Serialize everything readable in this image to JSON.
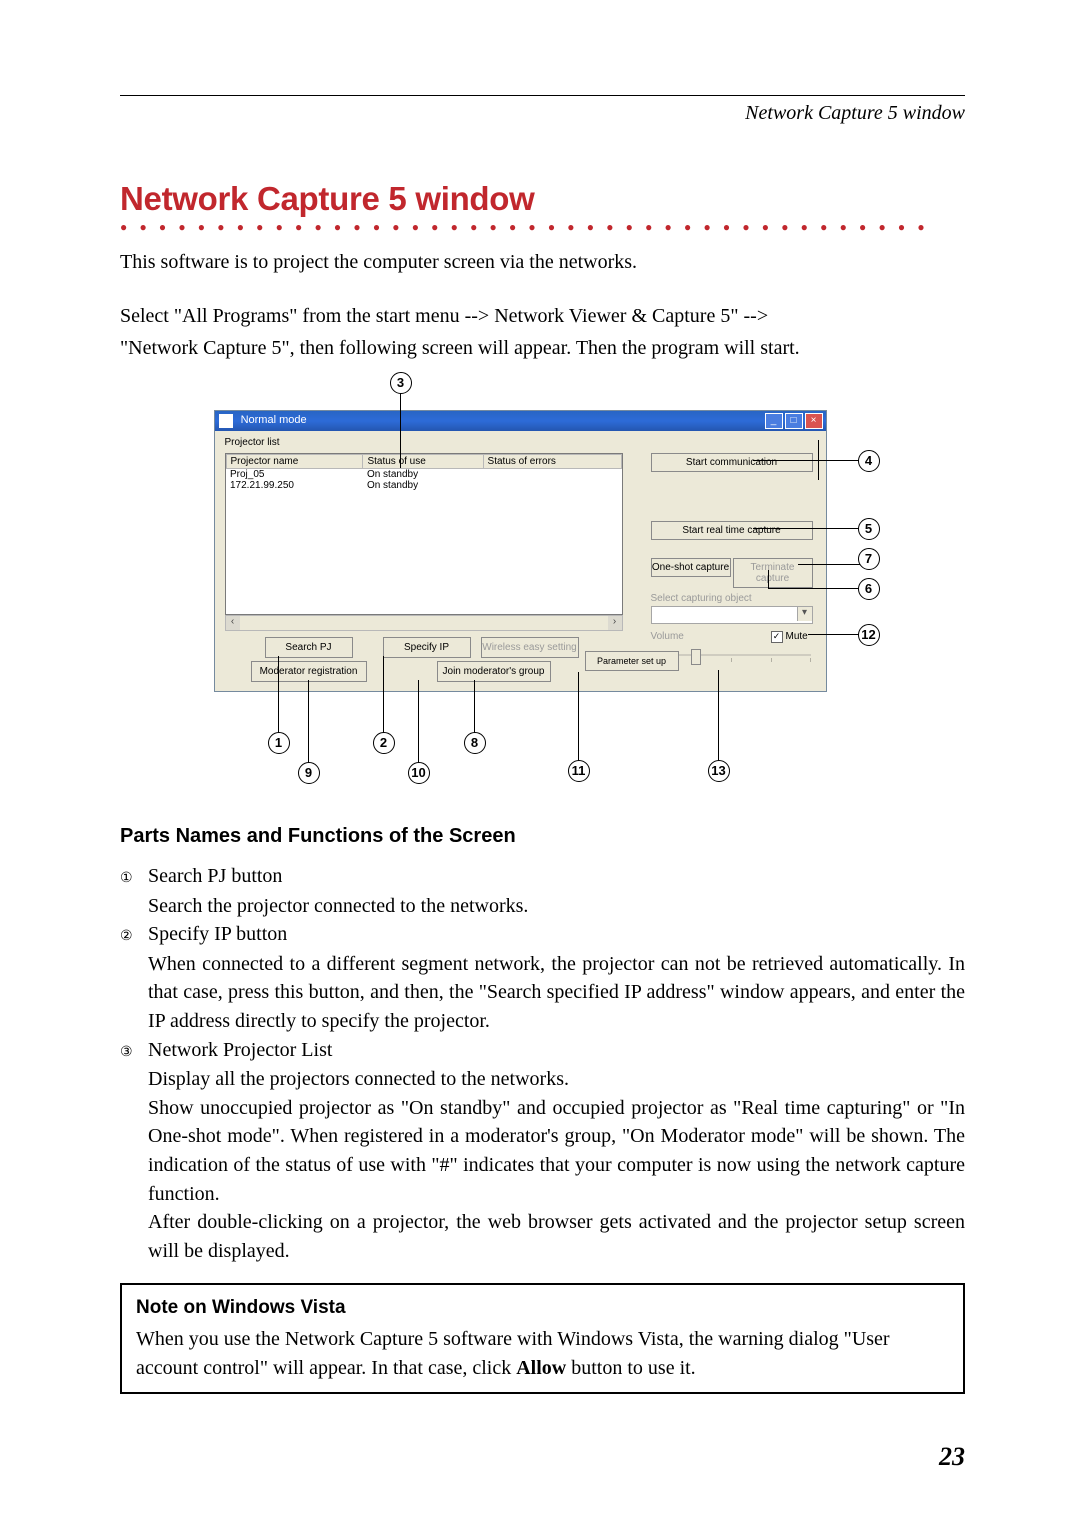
{
  "header": {
    "breadcrumb": "Network Capture 5 window"
  },
  "title": "Network Capture 5 window",
  "intro1": "This software is to project the computer screen via the networks.",
  "intro2": "Select  \"All Programs\" from the start menu --> Network Viewer & Capture 5\" -->",
  "intro3": "\"Network Capture 5\", then following screen will appear. Then the program will start.",
  "win": {
    "title": "Normal mode",
    "projector_list_label": "Projector list",
    "columns": {
      "name": "Projector name",
      "status": "Status of use",
      "errors": "Status of errors"
    },
    "rows": [
      {
        "name": "Proj_05",
        "status": "On standby"
      },
      {
        "name": "172.21.99.250",
        "status": "On standby"
      }
    ],
    "buttons": {
      "start_comm": "Start communication",
      "start_rt": "Start real time capture",
      "oneshot": "One-shot capture",
      "terminate": "Terminate capture",
      "select_obj_label": "Select capturing object",
      "volume_label": "Volume",
      "mute": "Mute",
      "search": "Search PJ",
      "specify": "Specify IP",
      "wireless": "Wireless easy setting",
      "param": "Parameter set up",
      "moderator": "Moderator registration",
      "join": "Join moderator's group"
    }
  },
  "callouts": [
    "①",
    "②",
    "③",
    "④",
    "⑤",
    "⑥",
    "⑦",
    "⑧",
    "⑨",
    "⑩",
    "⑪",
    "⑫",
    "⑬"
  ],
  "parts_heading": "Parts Names and Functions of the Screen",
  "parts": [
    {
      "num": "①",
      "label": "Search PJ button",
      "desc": "Search the projector connected to the networks."
    },
    {
      "num": "②",
      "label": "Specify IP button",
      "desc": "When connected to a different segment network, the projector can not be retrieved automatically. In that case, press this button, and then, the \"Search specified IP address\" window appears, and enter the IP address directly to specify the projector."
    },
    {
      "num": "③",
      "label": "Network Projector List",
      "desc": "Display all the projectors connected to the networks.\nShow unoccupied projector as \"On standby\" and occupied projector as \"Real time capturing\" or \"In One-shot mode\".  When registered in a moderator's group, \"On Moderator mode\" will be shown. The indication of the status of use with \"#\" indicates that your computer is now using the network capture function.\nAfter double-clicking on a projector, the web browser gets activated and the projector setup screen will be displayed."
    }
  ],
  "note": {
    "title": "Note on Windows Vista",
    "body1": "When you use the Network Capture 5 software with Windows Vista, the warning dialog \"User account control\" will appear. In that case, click ",
    "bold": "Allow",
    "body2": " button to use it."
  },
  "page_number": "23"
}
